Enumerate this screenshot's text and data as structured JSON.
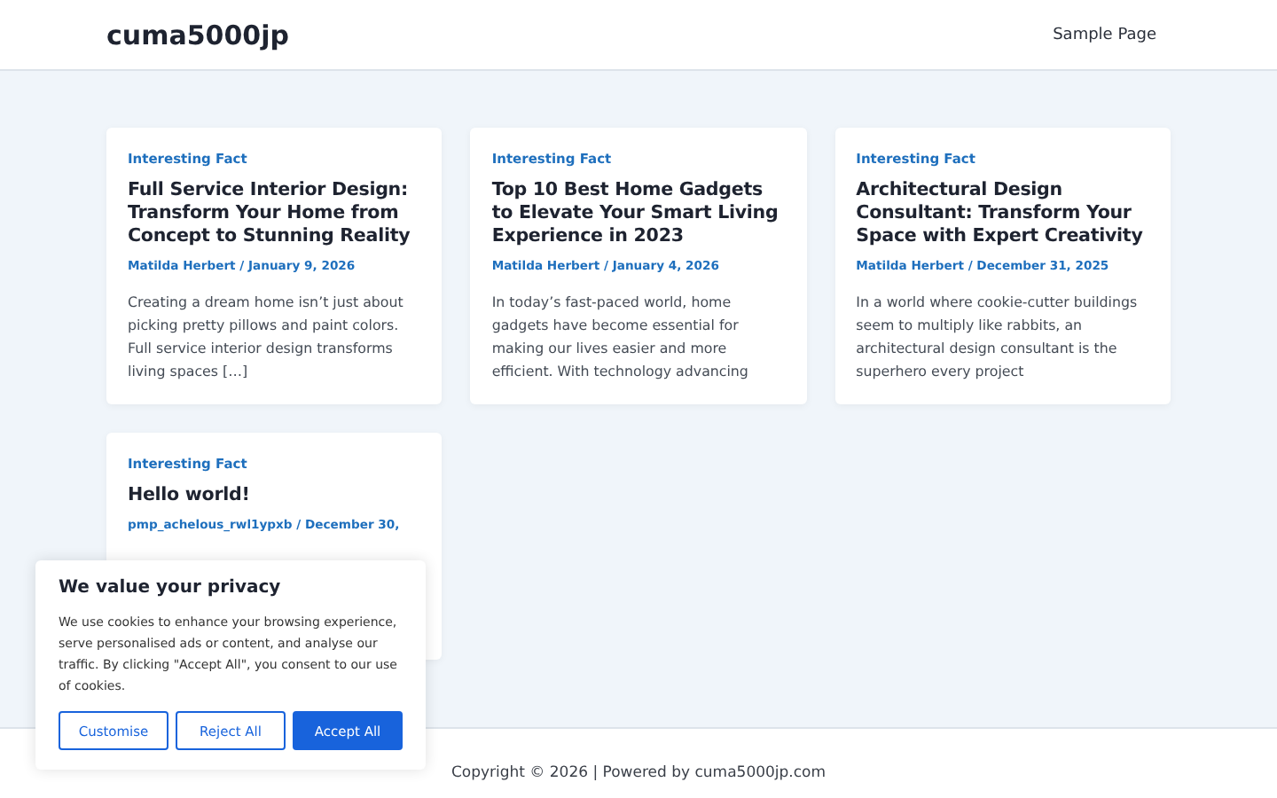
{
  "site": {
    "title": "cuma5000jp",
    "nav": [
      "Sample Page"
    ]
  },
  "posts": [
    {
      "category": "Interesting Fact",
      "title": "Full Service Interior Design: Transform Your Home from Concept to Stunning Reality",
      "meta": "Matilda Herbert / January 9, 2026",
      "excerpt": "Creating a dream home isn’t just about picking pretty pillows and paint colors. Full service interior design transforms living spaces […]"
    },
    {
      "category": "Interesting Fact",
      "title": "Top 10 Best Home Gadgets to Elevate Your Smart Living Experience in 2023",
      "meta": "Matilda Herbert / January 4, 2026",
      "excerpt": "In today’s fast-paced world, home gadgets have become essential for making our lives easier and more efficient. With technology advancing"
    },
    {
      "category": "Interesting Fact",
      "title": "Architectural Design Consultant: Transform Your Space with Expert Creativity",
      "meta": "Matilda Herbert / December 31, 2025",
      "excerpt": "In a world where cookie-cutter buildings seem to multiply like rabbits, an architectural design consultant is the superhero every project"
    },
    {
      "category": "Interesting Fact",
      "title": "Hello world!",
      "meta": "pmp_achelous_rwl1ypxb / December 30,"
    }
  ],
  "footer": "Copyright © 2026 | Powered by cuma5000jp.com",
  "cookie_banner": {
    "title": "We value your privacy",
    "text": "We use cookies to enhance your browsing experience, serve personalised ads or content, and analyse our traffic. By clicking \"Accept All\", you consent to our use of cookies.",
    "buttons": [
      {
        "label": "Customise",
        "kind": "outline"
      },
      {
        "label": "Reject All",
        "kind": "outline"
      },
      {
        "label": "Accept All",
        "kind": "primary"
      }
    ]
  }
}
